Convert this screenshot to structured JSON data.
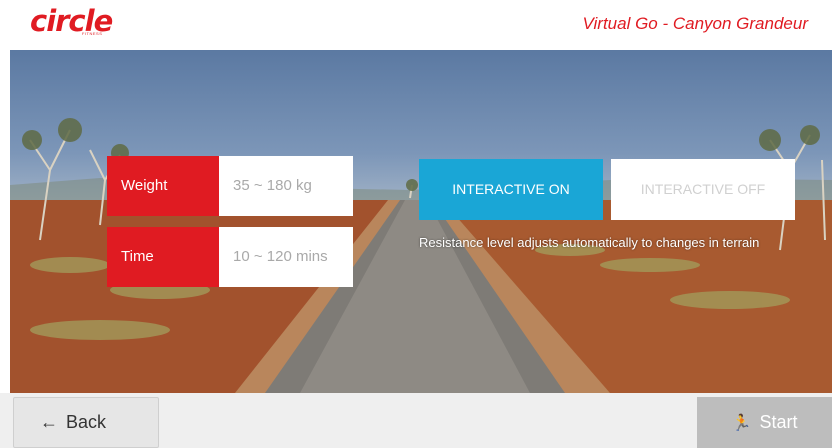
{
  "header": {
    "logo_text": "circle",
    "logo_subtext": "FITNESS",
    "program_title": "Virtual Go - Canyon Grandeur"
  },
  "settings": {
    "weight": {
      "label": "Weight",
      "value": "35 ~ 180 kg"
    },
    "time": {
      "label": "Time",
      "value": "10 ~ 120 mins"
    }
  },
  "interactive": {
    "on_label": "INTERACTIVE ON",
    "off_label": "INTERACTIVE OFF",
    "selected": "on",
    "hint": "Resistance level adjusts automatically to changes in terrain"
  },
  "footer": {
    "back_label": "Back",
    "start_label": "Start"
  },
  "icons": {
    "back": "arrow-left-icon",
    "start": "running-person-icon"
  },
  "colors": {
    "brand_red": "#e01b22",
    "interactive_blue": "#1aa6d6",
    "start_disabled": "#bdbdbd"
  }
}
